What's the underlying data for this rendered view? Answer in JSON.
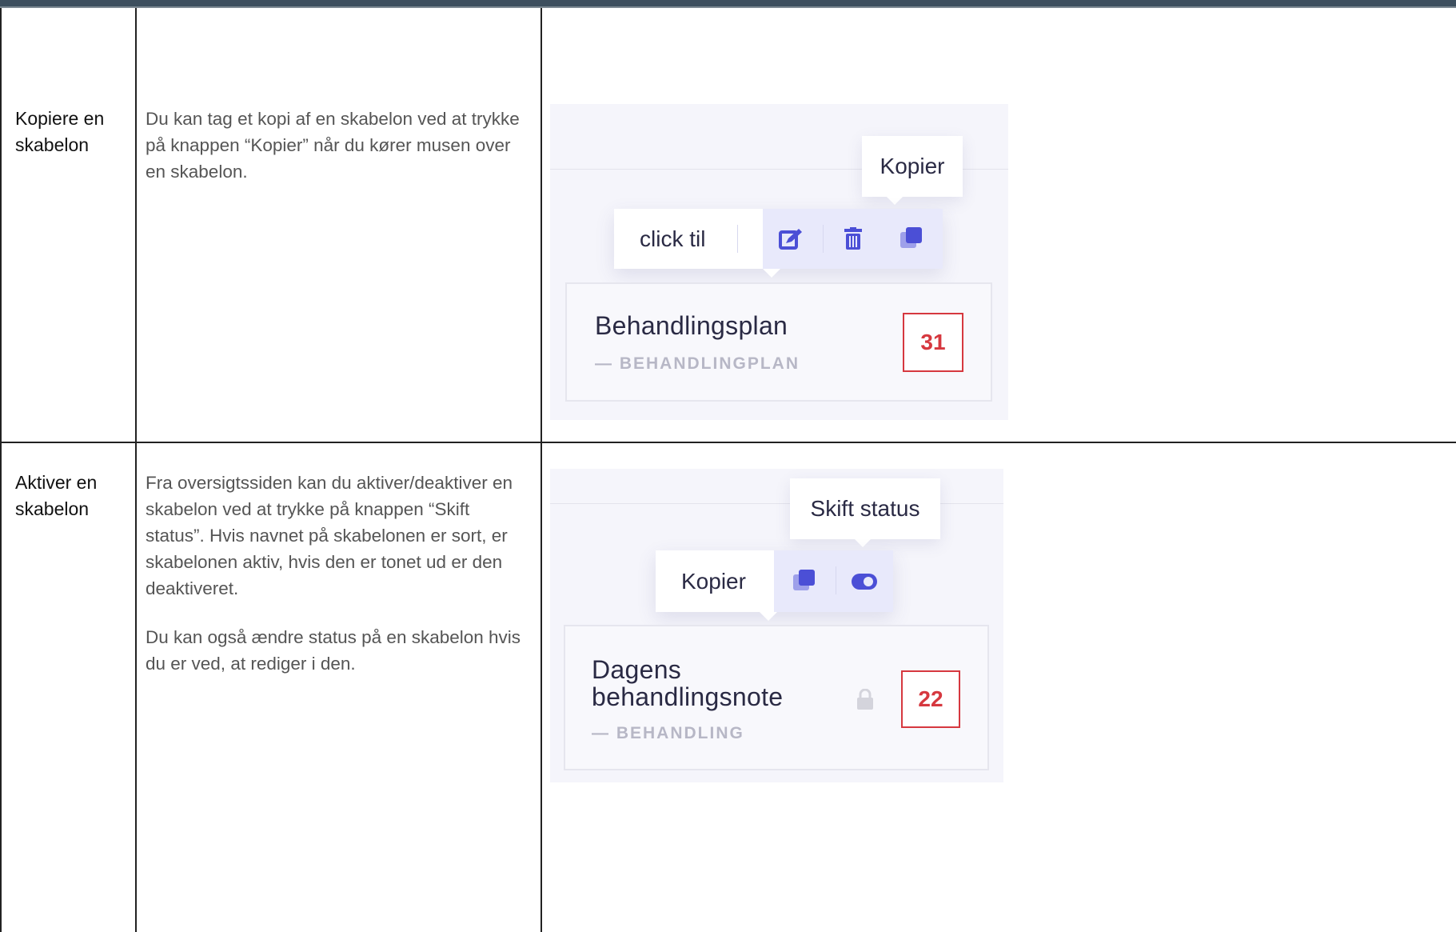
{
  "rows": [
    {
      "label": "Kopiere en skabelon",
      "paragraphs": [
        "Du kan tag et kopi af en skabelon ved at trykke på knappen “Kopier” når du kører musen over en skabelon."
      ],
      "screenshot": {
        "tooltip": "Kopier",
        "toolbar_label": "click til",
        "icons": [
          "edit-icon",
          "trash-icon",
          "copy-icon"
        ],
        "card_title": "Behandlingsplan",
        "card_subtitle": "— BEHANDLINGPLAN",
        "badge": "31"
      }
    },
    {
      "label": "Aktiver en skabelon",
      "paragraphs": [
        "Fra oversigtssiden kan du aktiver/deaktiver en skabelon ved at trykke på knappen “Skift status”. Hvis navnet på skabelonen er sort, er skabelonen aktiv, hvis den er tonet ud er den deaktiveret.",
        "Du kan også ændre status på en skabelon hvis du er ved, at rediger i den."
      ],
      "screenshot": {
        "tooltip": "Skift status",
        "toolbar_label": "Kopier",
        "icons": [
          "copy-icon",
          "toggle-icon"
        ],
        "card_title_line1": "Dagens",
        "card_title_line2": "behandlingsnote",
        "card_subtitle": "— BEHANDLING",
        "badge": "22"
      }
    }
  ],
  "colors": {
    "accent_icon": "#4b4fd6",
    "badge_red": "#d6383f",
    "header_bar": "#3d4f5e"
  }
}
